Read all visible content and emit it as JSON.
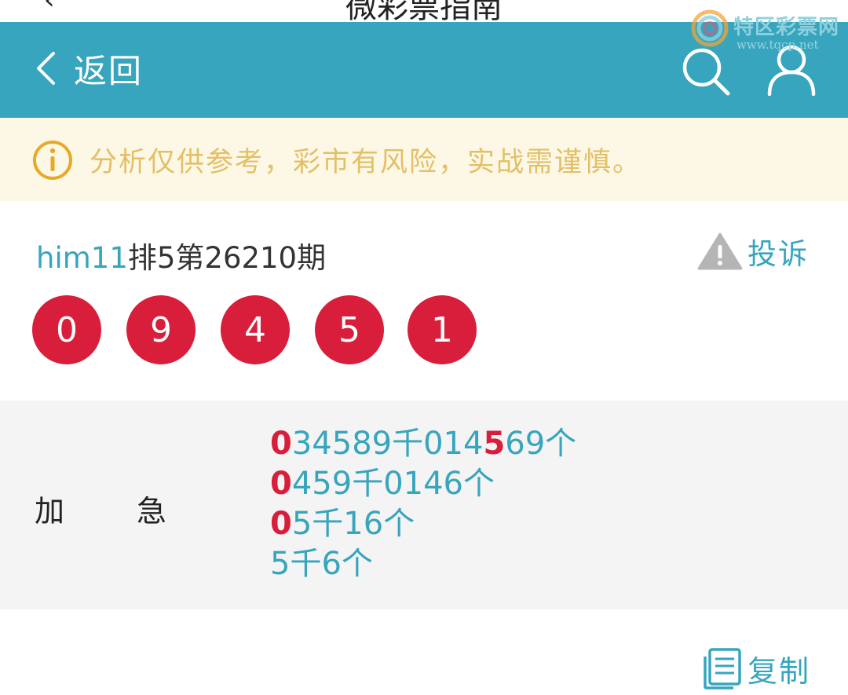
{
  "status": {
    "title": "微彩票指南"
  },
  "watermark": {
    "name": "特区彩票网",
    "url": "www.tqcp.net"
  },
  "nav": {
    "back_label": "返回"
  },
  "notice": {
    "text": "分析仅供参考，彩市有风险，实战需谨慎。"
  },
  "period": {
    "user": "him11",
    "title": "排5第26210期"
  },
  "complain": {
    "label": "投诉"
  },
  "balls": [
    "0",
    "9",
    "4",
    "5",
    "1"
  ],
  "detail": {
    "label_a": "加",
    "label_b": "急",
    "lines": [
      {
        "parts": [
          {
            "text": "0",
            "hl": true
          },
          {
            "text": "34589千014",
            "hl": false
          },
          {
            "text": "5",
            "hl": true
          },
          {
            "text": "69个",
            "hl": false
          }
        ]
      },
      {
        "parts": [
          {
            "text": "0",
            "hl": true
          },
          {
            "text": "459千0146个",
            "hl": false
          }
        ]
      },
      {
        "parts": [
          {
            "text": "0",
            "hl": true
          },
          {
            "text": "5千16个",
            "hl": false
          }
        ]
      },
      {
        "parts": [
          {
            "text": "5千6个",
            "hl": false
          }
        ]
      }
    ]
  },
  "copy": {
    "label": "复制"
  },
  "colors": {
    "primary": "#37a5bd",
    "ball": "#d81e3a",
    "notice_text": "#e3bf66",
    "notice_bg": "#fdf8e6"
  }
}
